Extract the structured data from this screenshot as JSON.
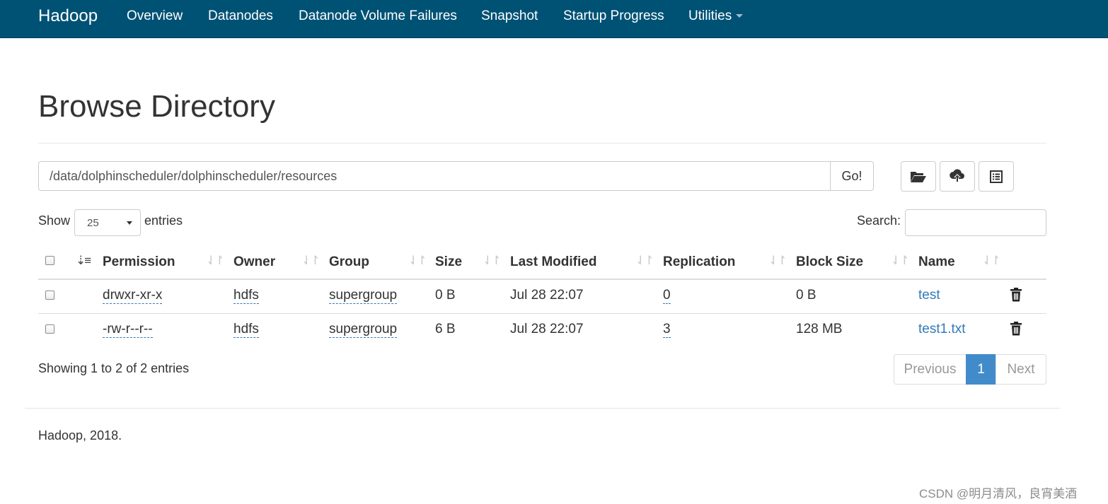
{
  "navbar": {
    "brand": "Hadoop",
    "items": [
      "Overview",
      "Datanodes",
      "Datanode Volume Failures",
      "Snapshot",
      "Startup Progress",
      "Utilities"
    ],
    "bg_color": "#005275"
  },
  "page_title": "Browse Directory",
  "path_bar": {
    "value": "/data/dolphinscheduler/dolphinscheduler/resources",
    "go_label": "Go!",
    "icons": [
      "folder-open-icon",
      "cloud-upload-icon",
      "list-alt-icon"
    ]
  },
  "table_controls": {
    "show_label": "Show",
    "page_length": "25",
    "entries_label": "entries",
    "search_label": "Search:",
    "search_value": ""
  },
  "table": {
    "columns": [
      "Permission",
      "Owner",
      "Group",
      "Size",
      "Last Modified",
      "Replication",
      "Block Size",
      "Name"
    ],
    "rows": [
      {
        "permission": "drwxr-xr-x",
        "owner": "hdfs",
        "group": "supergroup",
        "size": "0 B",
        "last_modified": "Jul 28 22:07",
        "replication": "0",
        "block_size": "0 B",
        "name": "test"
      },
      {
        "permission": "-rw-r--r--",
        "owner": "hdfs",
        "group": "supergroup",
        "size": "6 B",
        "last_modified": "Jul 28 22:07",
        "replication": "3",
        "block_size": "128 MB",
        "name": "test1.txt"
      }
    ]
  },
  "info": "Showing 1 to 2 of 2 entries",
  "pagination": {
    "previous": "Previous",
    "current": "1",
    "next": "Next",
    "active_color": "#428bca"
  },
  "footer": "Hadoop, 2018.",
  "watermark": "CSDN @明月清风，良宵美酒"
}
